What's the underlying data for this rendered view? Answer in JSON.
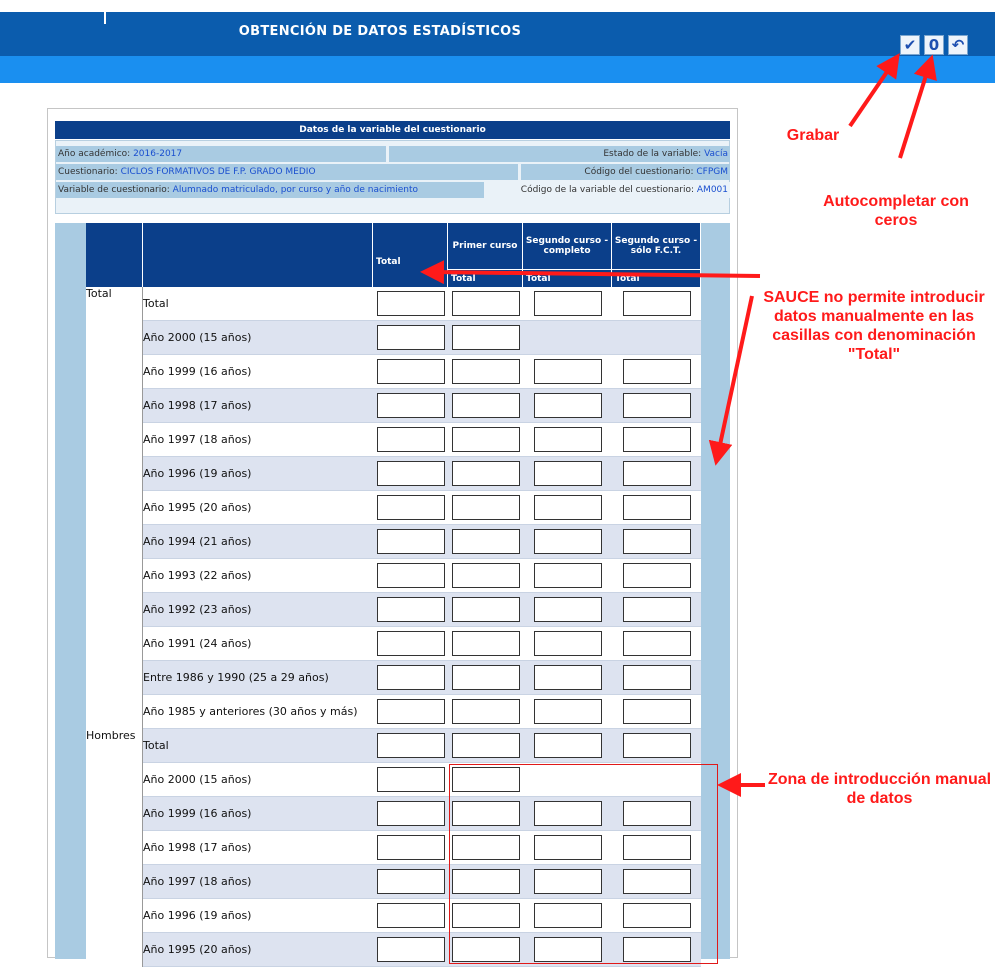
{
  "header": {
    "title": "OBTENCIÓN DE DATOS ESTADÍSTICOS"
  },
  "toolbar": {
    "grabar_icon": "✔",
    "autocompletar_icon": "0",
    "deshacer_icon": "↶"
  },
  "info": {
    "title": "Datos de la variable del cuestionario",
    "ano_label": "Año académico: ",
    "ano_value": "2016-2017",
    "estado_label": "Estado de la variable: ",
    "estado_value": "Vacía",
    "cuestionario_label": "Cuestionario: ",
    "cuestionario_value": "CICLOS FORMATIVOS DE F.P. GRADO MEDIO",
    "codigo_label": "Código del cuestionario: ",
    "codigo_value": "CFPGM",
    "variable_label": "Variable de cuestionario: ",
    "variable_value": "Alumnado matriculado, por curso y año de nacimiento",
    "codvar_label": "Código de la variable del cuestionario: ",
    "codvar_value": "AM001"
  },
  "table": {
    "col_total": "Total",
    "col_primer": "Primer curso",
    "col_seg_completo": "Segundo curso - completo",
    "col_seg_fct": "Segundo curso - sólo F.C.T.",
    "sub_total": "Total",
    "groups": [
      {
        "name": "Total",
        "rows": [
          {
            "label": "Total",
            "p": true,
            "s": true,
            "f": true
          },
          {
            "label": "Año 2000 (15 años)",
            "p": true,
            "s": false,
            "f": false
          },
          {
            "label": "Año 1999 (16 años)",
            "p": true,
            "s": true,
            "f": true
          },
          {
            "label": "Año 1998 (17 años)",
            "p": true,
            "s": true,
            "f": true
          },
          {
            "label": "Año 1997 (18 años)",
            "p": true,
            "s": true,
            "f": true
          },
          {
            "label": "Año 1996 (19 años)",
            "p": true,
            "s": true,
            "f": true
          },
          {
            "label": "Año 1995 (20 años)",
            "p": true,
            "s": true,
            "f": true
          },
          {
            "label": "Año 1994 (21 años)",
            "p": true,
            "s": true,
            "f": true
          },
          {
            "label": "Año 1993 (22 años)",
            "p": true,
            "s": true,
            "f": true
          },
          {
            "label": "Año 1992 (23 años)",
            "p": true,
            "s": true,
            "f": true
          },
          {
            "label": "Año 1991 (24 años)",
            "p": true,
            "s": true,
            "f": true
          },
          {
            "label": "Entre 1986 y 1990 (25 a 29 años)",
            "p": true,
            "s": true,
            "f": true
          },
          {
            "label": "Año 1985 y anteriores (30 años y más)",
            "p": true,
            "s": true,
            "f": true
          }
        ]
      },
      {
        "name": "Hombres",
        "rows": [
          {
            "label": "Total",
            "p": true,
            "s": true,
            "f": true
          },
          {
            "label": "Año 2000 (15 años)",
            "p": true,
            "s": false,
            "f": false
          },
          {
            "label": "Año 1999 (16 años)",
            "p": true,
            "s": true,
            "f": true
          },
          {
            "label": "Año 1998 (17 años)",
            "p": true,
            "s": true,
            "f": true
          },
          {
            "label": "Año 1997 (18 años)",
            "p": true,
            "s": true,
            "f": true
          },
          {
            "label": "Año 1996 (19 años)",
            "p": true,
            "s": true,
            "f": true
          },
          {
            "label": "Año 1995 (20 años)",
            "p": true,
            "s": true,
            "f": true
          }
        ]
      }
    ]
  },
  "annotations": {
    "grabar": "Grabar",
    "autocompletar": "Autocompletar con ceros",
    "sauce": "SAUCE no permite introducir datos manualmente en las casillas con denominación \"Total\"",
    "zona": "Zona de introducción manual de datos"
  },
  "colors": {
    "accent": "#ff1a1a",
    "header_blue": "#0b3f8a",
    "title_blue": "#0b5cad"
  }
}
